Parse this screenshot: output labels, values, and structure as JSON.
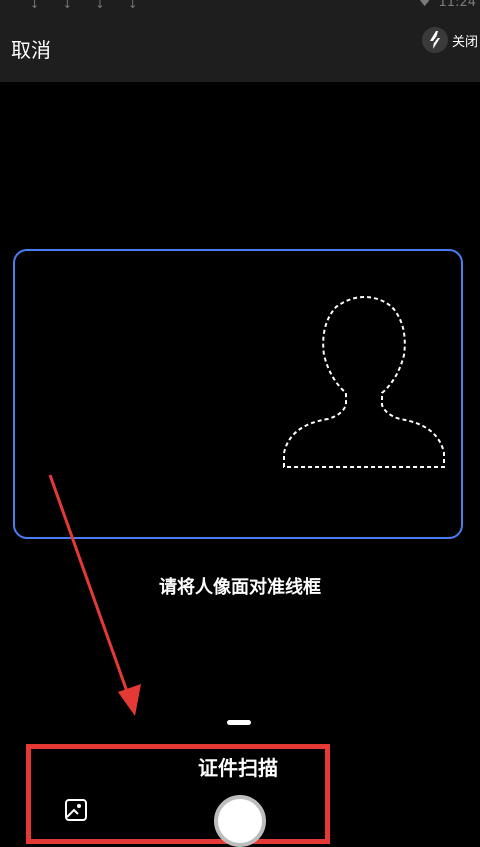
{
  "status_bar": {
    "download_icons": "↓ ↓ ↓ ↓",
    "time": "11:24"
  },
  "top_bar": {
    "cancel_label": "取消",
    "flash_label": "关闭"
  },
  "scan": {
    "hint": "请将人像面对准线框",
    "mode_label": "证件扫描"
  },
  "colors": {
    "frame_border": "#4a7ef0",
    "annotation": "#e53935",
    "background": "#000000"
  }
}
